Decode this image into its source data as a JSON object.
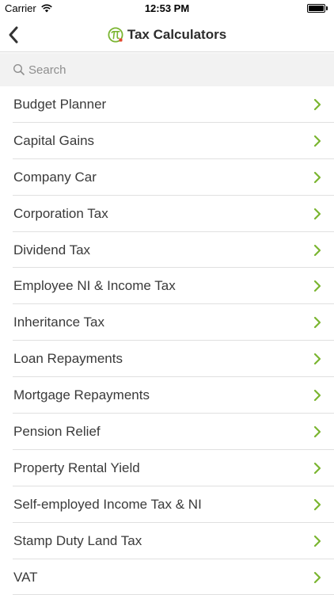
{
  "status_bar": {
    "carrier": "Carrier",
    "time": "12:53 PM",
    "wifi_icon": "wifi-icon",
    "battery_icon": "battery-icon"
  },
  "nav": {
    "title": "Tax Calculators",
    "back_icon": "chevron-left-icon",
    "logo_icon": "pi-logo-icon"
  },
  "search": {
    "placeholder": "Search",
    "value": ""
  },
  "colors": {
    "accent": "#7ab530",
    "separator": "#e0e0e0",
    "search_background": "#f2f2f2"
  },
  "calculators": [
    {
      "label": "Budget Planner"
    },
    {
      "label": "Capital Gains"
    },
    {
      "label": "Company Car"
    },
    {
      "label": "Corporation Tax"
    },
    {
      "label": "Dividend Tax"
    },
    {
      "label": "Employee NI & Income Tax"
    },
    {
      "label": "Inheritance Tax"
    },
    {
      "label": "Loan Repayments"
    },
    {
      "label": "Mortgage Repayments"
    },
    {
      "label": "Pension Relief"
    },
    {
      "label": "Property Rental Yield"
    },
    {
      "label": "Self-employed Income Tax & NI"
    },
    {
      "label": "Stamp Duty Land Tax"
    },
    {
      "label": "VAT"
    }
  ]
}
